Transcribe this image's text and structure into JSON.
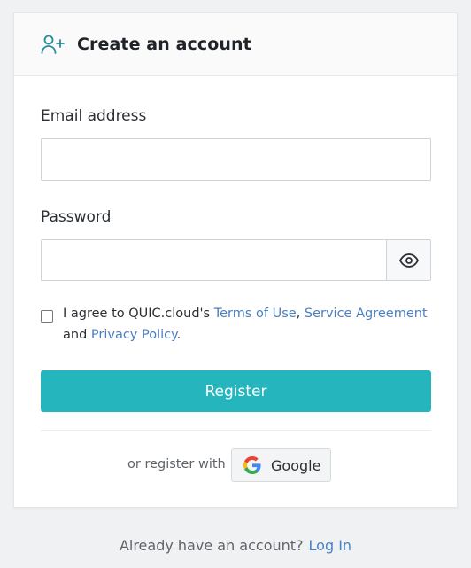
{
  "header": {
    "title": "Create an account",
    "icon": "user-plus-icon"
  },
  "form": {
    "email_label": "Email address",
    "email_value": "",
    "password_label": "Password",
    "password_value": "",
    "show_password_icon": "eye-icon",
    "agree": {
      "prefix": "I agree to QUIC.cloud's ",
      "terms_link": "Terms of Use",
      "comma": ", ",
      "service_link": "Service Agreement",
      "and": "and ",
      "privacy_link": "Privacy Policy",
      "period": ".",
      "checked": false
    },
    "register_label": "Register"
  },
  "alt_signup": {
    "or_text": "or register with",
    "google_label": "Google"
  },
  "footer": {
    "text": "Already have an account?",
    "login_link": "Log In"
  },
  "colors": {
    "accent": "#24b5bd",
    "link": "#4a7fc1",
    "icon_teal": "#2a8c99"
  }
}
